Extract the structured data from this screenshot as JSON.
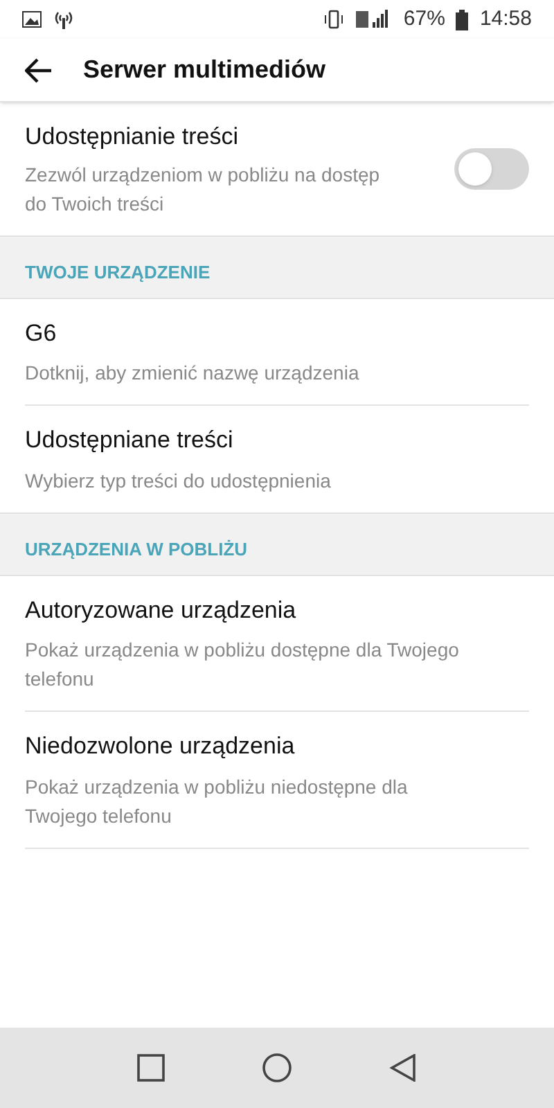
{
  "status_bar": {
    "battery": "67%",
    "time": "14:58"
  },
  "header": {
    "title": "Serwer multimediów"
  },
  "sharing": {
    "title": "Udostępnianie treści",
    "subtitle": "Zezwól urządzeniom w pobliżu na dostęp do Twoich treści",
    "on": false
  },
  "sections": [
    {
      "title": "TWOJE URZĄDZENIE",
      "items": [
        {
          "title": "G6",
          "subtitle": "Dotknij, aby zmienić nazwę urządzenia"
        },
        {
          "title": "Udostępniane treści",
          "subtitle": "Wybierz typ treści do udostępnienia"
        }
      ]
    },
    {
      "title": "URZĄDZENIA W POBLIŻU",
      "items": [
        {
          "title": "Autoryzowane urządzenia",
          "subtitle": "Pokaż urządzenia w pobliżu dostępne dla Twojego telefonu"
        },
        {
          "title": "Niedozwolone urządzenia",
          "subtitle": "Pokaż urządzenia w pobliżu niedostępne dla Twojego telefonu"
        }
      ]
    }
  ]
}
